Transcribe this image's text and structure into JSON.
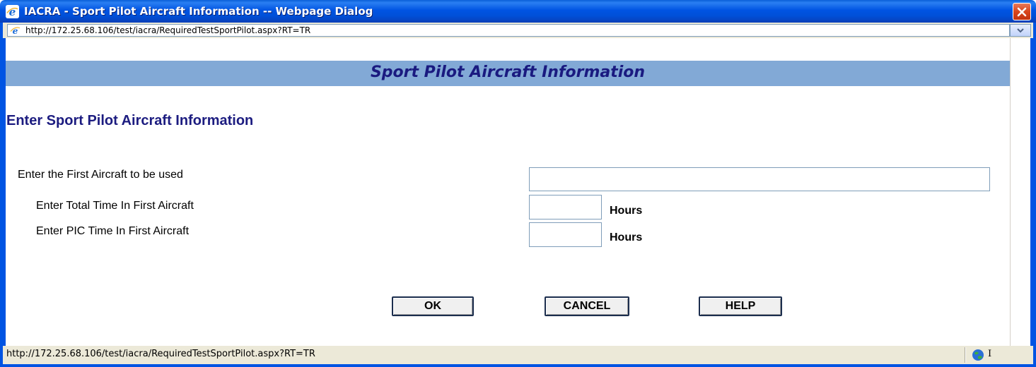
{
  "window": {
    "title": "IACRA - Sport Pilot Aircraft Information -- Webpage Dialog",
    "app_icon": "ie-icon",
    "close_icon": "close-icon"
  },
  "address": {
    "url": "http://172.25.68.106/test/iacra/RequiredTestSportPilot.aspx?RT=TR"
  },
  "header": {
    "title": "Sport Pilot Aircraft Information"
  },
  "form": {
    "section_title": "Enter Sport Pilot Aircraft Information",
    "first_aircraft_label": "Enter the First Aircraft to be used",
    "first_aircraft_value": "",
    "total_time_label": "Enter Total Time In First Aircraft",
    "total_time_value": "",
    "total_time_unit": "Hours",
    "pic_time_label": "Enter PIC Time In First Aircraft",
    "pic_time_value": "",
    "pic_time_unit": "Hours"
  },
  "buttons": {
    "ok": "OK",
    "cancel": "CANCEL",
    "help": "HELP"
  },
  "status": {
    "text": "http://172.25.68.106/test/iacra/RequiredTestSportPilot.aspx?RT=TR",
    "zone_icon": "globe-icon",
    "zone_text": "I"
  },
  "colors": {
    "titlebar": "#0054e3",
    "header_band": "#82a9d6",
    "header_text": "#1a1a80",
    "section_text": "#1c1c80"
  }
}
